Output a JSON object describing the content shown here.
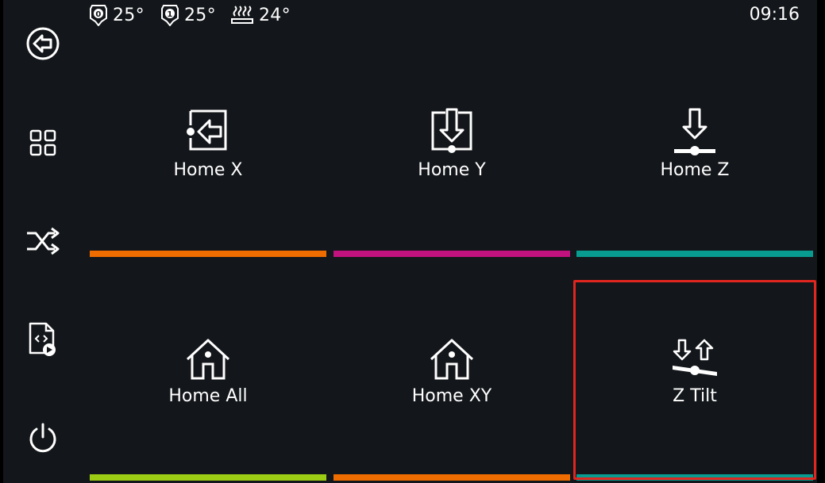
{
  "status_bar": {
    "sensors": [
      {
        "name": "extruder0",
        "icon": "extruder-0-icon",
        "value": "25°"
      },
      {
        "name": "extruder1",
        "icon": "extruder-1-icon",
        "value": "25°"
      },
      {
        "name": "heater_bed",
        "icon": "heated-bed-icon",
        "value": "24°"
      }
    ],
    "time": "09:16"
  },
  "sidebar": {
    "items": [
      {
        "icon": "back-arrow-icon"
      },
      {
        "icon": "grid-menu-icon"
      },
      {
        "icon": "shuffle-icon"
      },
      {
        "icon": "gcode-file-play-icon"
      },
      {
        "icon": "power-icon"
      }
    ]
  },
  "buttons": [
    {
      "label": "Home X",
      "icon": "home-x-icon",
      "color": "#ef6c00"
    },
    {
      "label": "Home Y",
      "icon": "home-y-icon",
      "color": "#c2127d"
    },
    {
      "label": "Home Z",
      "icon": "home-z-icon",
      "color": "#089b90"
    },
    {
      "label": "Home All",
      "icon": "home-all-icon",
      "color": "#9ccc14"
    },
    {
      "label": "Home XY",
      "icon": "home-xy-icon",
      "color": "#ef6c00"
    },
    {
      "label": "Z Tilt",
      "icon": "z-tilt-icon",
      "color": "#089b90"
    }
  ],
  "colors": {
    "background": "#13161a",
    "selection": "#e0261e"
  }
}
